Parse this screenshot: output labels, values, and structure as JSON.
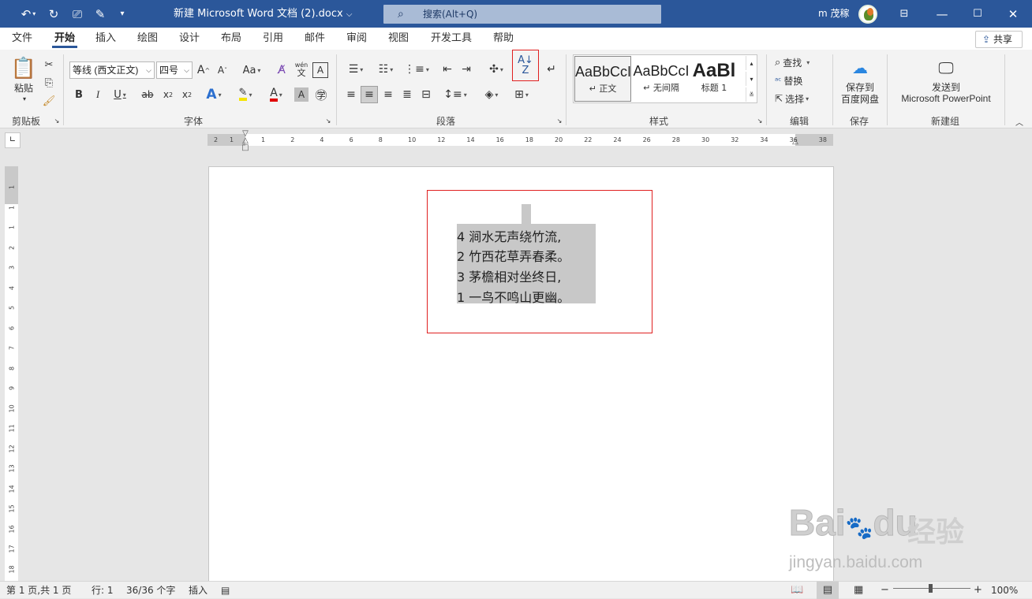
{
  "titlebar": {
    "title": "新建 Microsoft Word 文档 (2).docx",
    "search_placeholder": "搜索(Alt+Q)",
    "user_name": "m 茂稼",
    "bg_color": "#2b579a"
  },
  "tabs": [
    "文件",
    "开始",
    "插入",
    "绘图",
    "设计",
    "布局",
    "引用",
    "邮件",
    "审阅",
    "视图",
    "开发工具",
    "帮助"
  ],
  "active_tab": "开始",
  "share_label": "共享",
  "ribbon": {
    "clipboard": {
      "paste_label": "粘贴",
      "group_label": "剪贴板"
    },
    "font": {
      "font_name": "等线 (西文正文)",
      "font_size": "四号",
      "case_label": "Aa",
      "group_label": "字体",
      "phonetic_top": "wén",
      "phonetic_bottom": "文"
    },
    "paragraph": {
      "group_label": "段落"
    },
    "styles": {
      "group_label": "样式",
      "items": [
        {
          "preview": "AaBbCcI",
          "name": "↵ 正文"
        },
        {
          "preview": "AaBbCcI",
          "name": "↵ 无间隔"
        },
        {
          "preview": "AaBl",
          "name": "标题 1"
        }
      ]
    },
    "editing": {
      "find": "查找",
      "replace": "替换",
      "select": "选择",
      "group_label": "编辑"
    },
    "save": {
      "line1": "保存到",
      "line2": "百度网盘",
      "group_label": "保存"
    },
    "new_group": {
      "line1": "发送到",
      "line2": "Microsoft PowerPoint",
      "group_label": "新建组"
    }
  },
  "ruler": {
    "h_labels": [
      "2",
      "1",
      "",
      "1",
      "2",
      "4",
      "6",
      "8",
      "10",
      "12",
      "14",
      "16",
      "18",
      "20",
      "22",
      "24",
      "26",
      "28",
      "30",
      "32",
      "34",
      "36",
      "38"
    ],
    "v_labels": [
      "1",
      "1",
      "1",
      "2",
      "3",
      "4",
      "5",
      "6",
      "7",
      "8",
      "9",
      "10",
      "11",
      "12",
      "13",
      "14",
      "15",
      "16",
      "17",
      "18"
    ]
  },
  "document": {
    "lines": [
      "4 涧水无声绕竹流,",
      "2 竹西花草弄春柔。",
      "3 茅檐相对坐终日,",
      "1 一鸟不鸣山更幽。"
    ]
  },
  "statusbar": {
    "page": "第 1 页,共 1 页",
    "line": "行: 1",
    "words": "36/36 个字",
    "insert_mode": "插入",
    "zoom": "100%"
  },
  "watermark": {
    "brand": "Bai",
    "brand2": "du",
    "cn": "经验",
    "url": "jingyan.baidu.com"
  }
}
